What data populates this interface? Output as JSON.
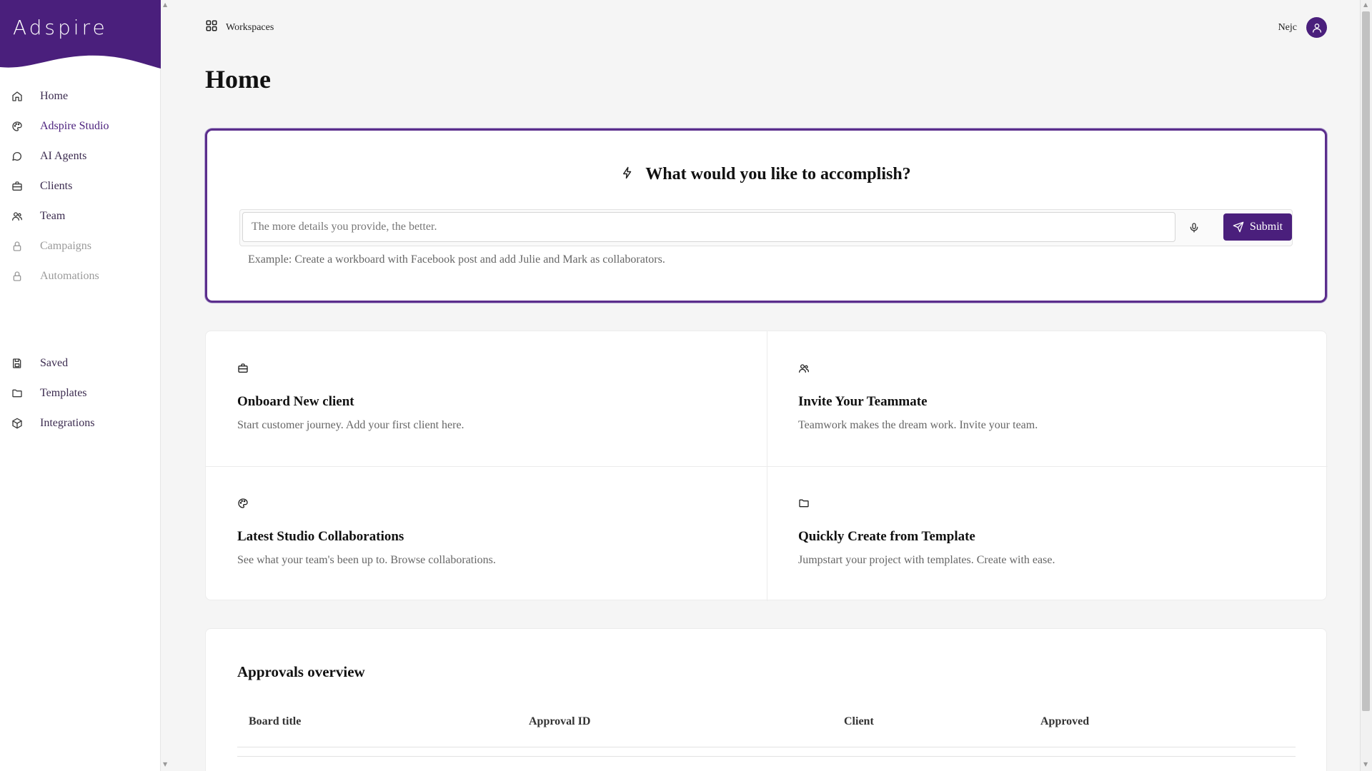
{
  "brand": {
    "logo_text": "Adspire",
    "accent": "#4a1f7c"
  },
  "sidebar": {
    "items": [
      {
        "label": "Home",
        "icon": "home-icon",
        "state": "normal"
      },
      {
        "label": "Adspire Studio",
        "icon": "palette-icon",
        "state": "active"
      },
      {
        "label": "AI Agents",
        "icon": "chat-icon",
        "state": "normal"
      },
      {
        "label": "Clients",
        "icon": "briefcase-icon",
        "state": "normal"
      },
      {
        "label": "Team",
        "icon": "users-icon",
        "state": "normal"
      },
      {
        "label": "Campaigns",
        "icon": "lock-icon",
        "state": "locked"
      },
      {
        "label": "Automations",
        "icon": "lock-icon",
        "state": "locked"
      }
    ],
    "secondary": [
      {
        "label": "Saved",
        "icon": "save-icon"
      },
      {
        "label": "Templates",
        "icon": "folder-icon"
      },
      {
        "label": "Integrations",
        "icon": "cube-icon"
      }
    ]
  },
  "topbar": {
    "workspaces_label": "Workspaces",
    "user_name": "Nejc"
  },
  "page": {
    "title": "Home"
  },
  "prompt": {
    "heading": "What would you like to accomplish?",
    "placeholder": "The more details you provide, the better.",
    "value": "",
    "submit_label": "Submit",
    "example": "Example: Create a workboard with Facebook post and add Julie and Mark as collaborators."
  },
  "actions": [
    {
      "title": "Onboard New client",
      "desc": "Start customer journey. Add your first client here.",
      "icon": "briefcase-icon"
    },
    {
      "title": "Invite Your Teammate",
      "desc": "Teamwork makes the dream work. Invite your team.",
      "icon": "users-icon"
    },
    {
      "title": "Latest Studio Collaborations",
      "desc": "See what your team's been up to. Browse collaborations.",
      "icon": "palette-icon"
    },
    {
      "title": "Quickly Create from Template",
      "desc": "Jumpstart your project with templates. Create with ease.",
      "icon": "folder-icon"
    }
  ],
  "approvals": {
    "title": "Approvals overview",
    "columns": [
      "Board title",
      "Approval ID",
      "Client",
      "Approved"
    ]
  }
}
